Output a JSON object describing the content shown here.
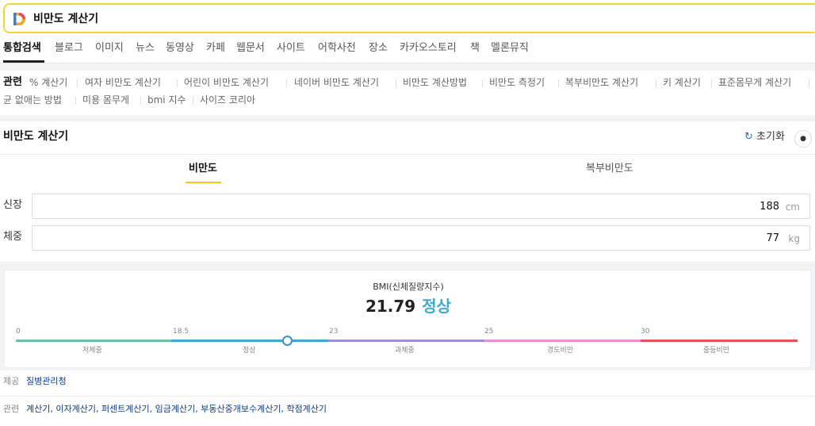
{
  "search": {
    "query": "비만도 계산기"
  },
  "tabs": [
    "통합검색",
    "블로그",
    "이미지",
    "뉴스",
    "동영상",
    "카페",
    "웹문서",
    "사이트",
    "어학사전",
    "장소",
    "카카오스토리",
    "책",
    "멜론뮤직"
  ],
  "related": {
    "title": "관련",
    "row1": [
      "% 계산기",
      "여자 비만도 계산기",
      "어린이 비만도 계산기",
      "네이버 비만도 계산기",
      "비만도 계산방법",
      "비만도 측정기",
      "복부비만도 계산기",
      "키 계산기",
      "표준몸무게 계산기"
    ],
    "row2": [
      "균 없애는 방법",
      "미용 몸무게",
      "bmi 지수",
      "사이즈 코리아"
    ]
  },
  "calculator": {
    "title": "비만도 계산기",
    "reset_label": "초기화",
    "reset_icon": "refresh-icon",
    "feedback_icon": "speech-bubble-icon",
    "modes": [
      "비만도",
      "복부비만도"
    ],
    "height": {
      "label": "신장",
      "value": "188",
      "unit": "cm"
    },
    "weight": {
      "label": "체중",
      "value": "77",
      "unit": "kg"
    }
  },
  "result": {
    "label": "BMI(신체질량지수)",
    "value": "21.79",
    "status": "정상",
    "bmi_value": 21.79,
    "scale_min": 0,
    "scale_max": 40,
    "ticks": [
      "0",
      "18.5",
      "23",
      "25",
      "30"
    ],
    "categories": [
      "저체중",
      "정상",
      "과체중",
      "경도비만",
      "중등비만"
    ],
    "colors": [
      "#66c4a0",
      "#3aaad6",
      "#9a8ee0",
      "#ef8fd0",
      "#e9505a"
    ]
  },
  "footer": {
    "source_label": "제공",
    "source": "질병관리청",
    "related_label": "관련",
    "related_links": "계산기, 이자계산기, 퍼센트계산기, 임금계산기, 부동산중개보수계산기, 학점계산기"
  }
}
